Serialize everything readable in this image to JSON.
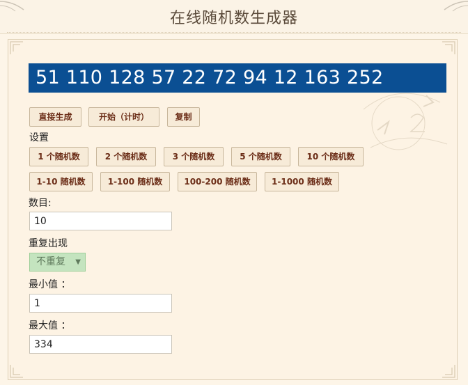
{
  "title": "在线随机数生成器",
  "result": "51 110 128 57 22 72 94 12 163 252",
  "actions": {
    "generate": "直接生成",
    "start_timed": "开始（计时）",
    "copy": "复制"
  },
  "settings_label": "设置",
  "presets_row1": [
    "1 个随机数",
    "2 个随机数",
    "3 个随机数",
    "5 个随机数",
    "10 个随机数"
  ],
  "presets_row2": [
    "1-10 随机数",
    "1-100 随机数",
    "100-200 随机数",
    "1-1000 随机数"
  ],
  "count": {
    "label": "数目:",
    "value": "10"
  },
  "repeat": {
    "label": "重复出现",
    "selected": "不重复"
  },
  "min": {
    "label": "最小值 ：",
    "value": "1"
  },
  "max": {
    "label": "最大值 ：",
    "value": "334"
  },
  "colors": {
    "result_bg": "#0b4f93",
    "button_text": "#6b2d17",
    "panel_bg": "#fdf3e4"
  }
}
